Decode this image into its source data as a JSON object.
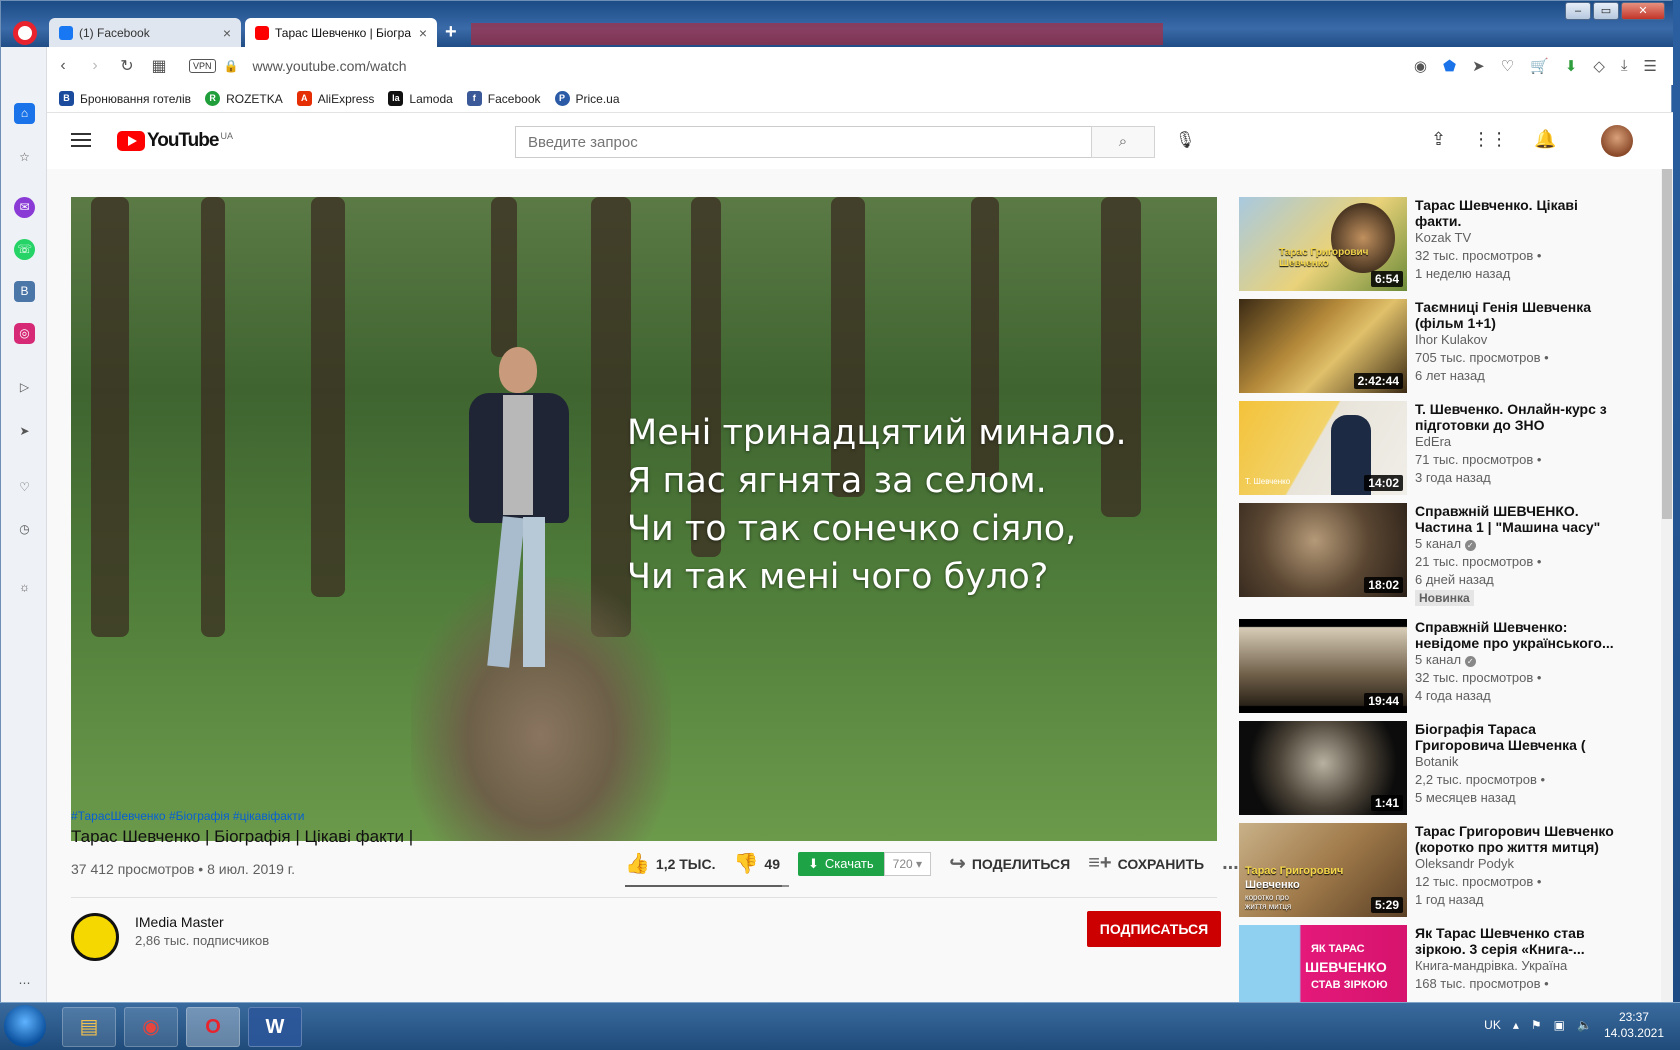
{
  "browser": {
    "tabs": [
      {
        "label": "(1) Facebook",
        "close": "×"
      },
      {
        "label": "Тарас Шевченко | Біогра",
        "close": "×"
      }
    ],
    "new_tab": "+",
    "vpn": "VPN",
    "url": "www.youtube.com/watch",
    "bookmarks": [
      {
        "label": "Бронювання готелів",
        "icon": "B",
        "color": "#1b4b9c"
      },
      {
        "label": "ROZETKA",
        "icon": "R",
        "color": "#1f9e3a"
      },
      {
        "label": "AliExpress",
        "icon": "A",
        "color": "#e62e04"
      },
      {
        "label": "Lamoda",
        "icon": "la",
        "color": "#111111"
      },
      {
        "label": "Facebook",
        "icon": "f",
        "color": "#3b5998"
      },
      {
        "label": "Price.ua",
        "icon": "P",
        "color": "#2b5aa6"
      }
    ]
  },
  "youtube": {
    "logo_text": "YouTube",
    "region": "UA",
    "search_placeholder": "Введите запрос",
    "video": {
      "lyrics": [
        "Мені тринадцятий минало.",
        "Я пас ягнята за селом.",
        "Чи то так сонечко сіяло,",
        "Чи так мені чого було?"
      ],
      "hashtags": "#ТарасШевченко #Біографія #цікавіфакти",
      "title": "Тарас Шевченко | Біографія | Цікаві факти |",
      "meta": "37 412 просмотров • 8 июл. 2019 г.",
      "likes": "1,2 ТЫС.",
      "like_fraction": 0.96,
      "dislikes": "49",
      "download_label": "Скачать",
      "quality": "720",
      "share_label": "ПОДЕЛИТЬСЯ",
      "save_label": "СОХРАНИТЬ",
      "more": "..."
    },
    "channel": {
      "name": "IMedia Master",
      "subs": "2,86 тыс. подписчиков",
      "subscribe_label": "ПОДПИСАТЬСЯ"
    },
    "recommendations": [
      {
        "title": "Тарас Шевченко. Цікаві факти.",
        "channel": "Kozak TV",
        "views": "32 тыс. просмотров •",
        "ago": "1 неделю назад",
        "duration": "6:54",
        "verified": false,
        "badge": ""
      },
      {
        "title": "Таємниці Генія Шевченка (фільм 1+1)",
        "channel": "Ihor Kulakov",
        "views": "705 тыс. просмотров •",
        "ago": "6 лет назад",
        "duration": "2:42:44",
        "verified": false,
        "badge": ""
      },
      {
        "title": "Т. Шевченко. Онлайн-курс з підготовки до ЗНО \"Лайфхак...",
        "channel": "EdEra",
        "views": "71 тыс. просмотров •",
        "ago": "3 года назад",
        "duration": "14:02",
        "verified": false,
        "badge": ""
      },
      {
        "title": "Справжній ШЕВЧЕНКО. Частина 1 | \"Машина часу\"",
        "channel": "5 канал",
        "views": "21 тыс. просмотров •",
        "ago": "6 дней назад",
        "duration": "18:02",
        "verified": true,
        "badge": "Новинка"
      },
      {
        "title": "Справжній Шевченко: невідоме про українського...",
        "channel": "5 канал",
        "views": "32 тыс. просмотров •",
        "ago": "4 года назад",
        "duration": "19:44",
        "verified": true,
        "badge": ""
      },
      {
        "title": "Біографія Тараса Григоровича Шевченка ( Українська...",
        "channel": "Botanik",
        "views": "2,2 тыс. просмотров •",
        "ago": "5 месяцев назад",
        "duration": "1:41",
        "verified": false,
        "badge": ""
      },
      {
        "title": "Тарас Григорович Шевченко (коротко про життя митця)",
        "channel": "Oleksandr Podyk",
        "views": "12 тыс. просмотров •",
        "ago": "1 год назад",
        "duration": "5:29",
        "verified": false,
        "badge": ""
      },
      {
        "title": "Як Тарас Шевченко став зіркою. 3 серія «Книга-...",
        "channel": "Книга-мандрівка. Україна",
        "views": "168 тыс. просмотров •",
        "ago": "",
        "duration": "",
        "verified": false,
        "badge": ""
      }
    ],
    "thumb_texts": {
      "t0": "Тарас Григорович Шевченко",
      "t2": "Т. Шевченко",
      "t6a": "Тарас Григорович",
      "t6b": "Шевченко",
      "t6c": "коротко про життя митця",
      "t7a": "ЯК ТАРАС",
      "t7b": "ШЕВЧЕНКО",
      "t7c": "СТАВ ЗІРКОЮ"
    }
  },
  "taskbar": {
    "lang": "UK",
    "time": "23:37",
    "date": "14.03.2021"
  }
}
